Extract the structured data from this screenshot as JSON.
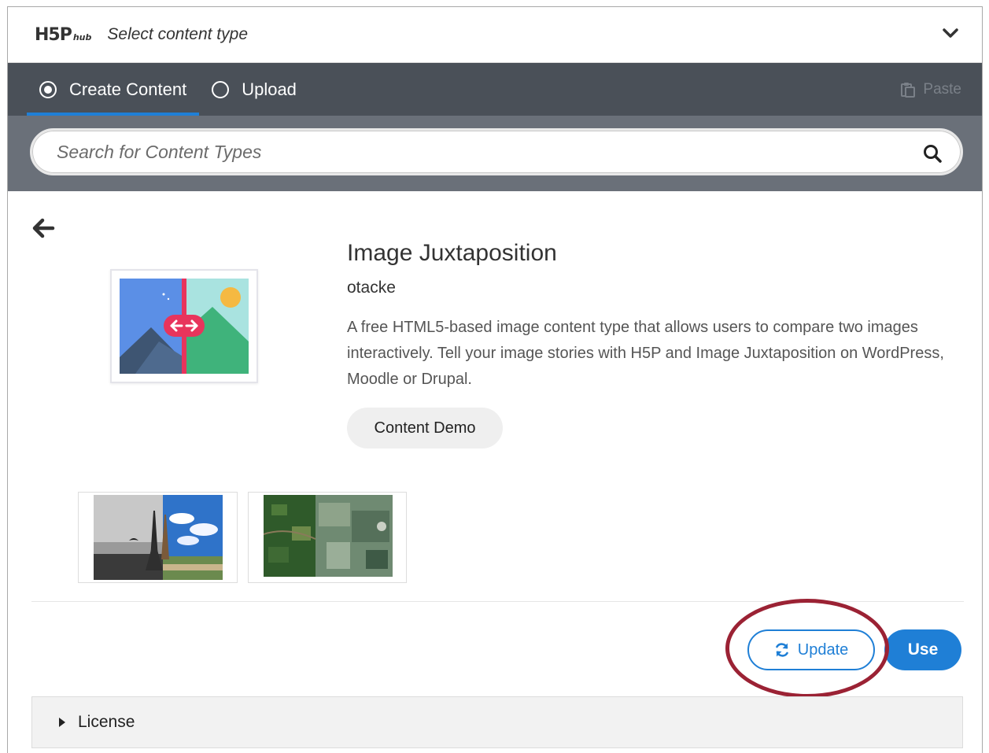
{
  "header": {
    "logo_main": "H5P",
    "logo_sub": "hub",
    "title": "Select content type"
  },
  "tabs": [
    {
      "label": "Create Content",
      "selected": true
    },
    {
      "label": "Upload",
      "selected": false
    }
  ],
  "paste": {
    "label": "Paste",
    "enabled": false
  },
  "search": {
    "placeholder": "Search for Content Types",
    "value": ""
  },
  "detail": {
    "title": "Image Juxtaposition",
    "author": "otacke",
    "description": "A free HTML5-based image content type that allows users to compare two images interactively. Tell your image stories with H5P and Image Juxtaposition on WordPress, Moodle or Drupal.",
    "demo_label": "Content Demo",
    "screenshots": [
      "eiffel-tower-comparison",
      "aerial-map-comparison"
    ]
  },
  "actions": {
    "update_label": "Update",
    "use_label": "Use"
  },
  "license": {
    "label": "License"
  },
  "colors": {
    "tabbar": "#4a5058",
    "search_band": "#6a7079",
    "accent": "#1f7fd6",
    "highlight": "#9b2234"
  }
}
